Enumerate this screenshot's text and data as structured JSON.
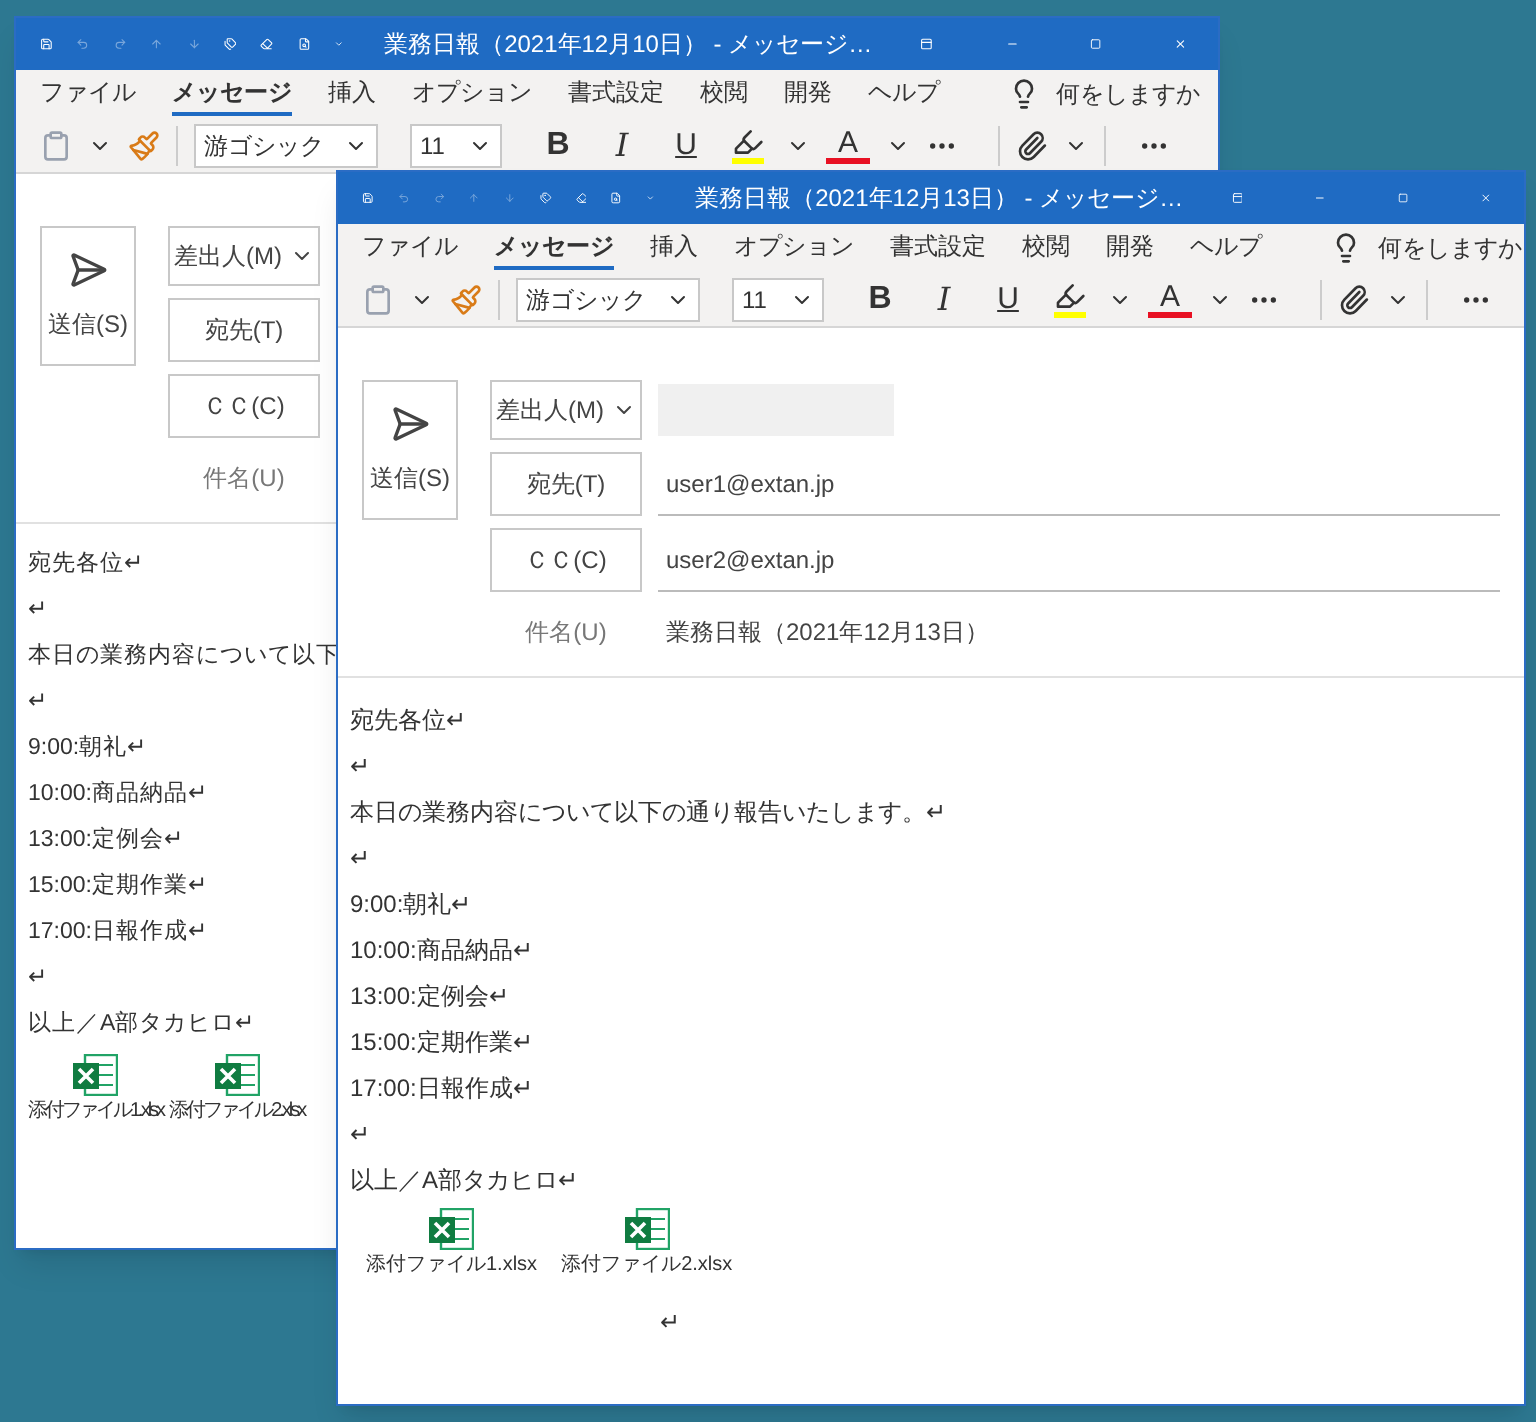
{
  "windows": [
    {
      "title": "業務日報（2021年12月10日） - メッセージ…",
      "menu": [
        {
          "label": "ファイル",
          "selected": false
        },
        {
          "label": "メッセージ",
          "selected": true
        },
        {
          "label": "挿入",
          "selected": false
        },
        {
          "label": "オプション",
          "selected": false
        },
        {
          "label": "書式設定",
          "selected": false
        },
        {
          "label": "校閲",
          "selected": false
        },
        {
          "label": "開発",
          "selected": false
        },
        {
          "label": "ヘルプ",
          "selected": false
        }
      ],
      "tell_me": "何をしますか",
      "font": "游ゴシック",
      "font_size": "11",
      "bold": "B",
      "italic": "I",
      "underline": "U",
      "font_color": "A",
      "send": "送信(S)",
      "from_label": "差出人(M)",
      "to_label": "宛先(T)",
      "cc_label": "ＣＣ(C)",
      "subject_label": "件名(U)",
      "body": [
        "宛先各位↵",
        "↵",
        "本日の業務内容について以下",
        "↵",
        "9:00:朝礼↵",
        "10:00:商品納品↵",
        "13:00:定例会↵",
        "15:00:定期作業↵",
        "17:00:日報作成↵",
        "↵",
        "以上／A部タカヒロ↵"
      ],
      "attachments": [
        "添付ファイル1.xlsx",
        "添付ファイル2.xlsx"
      ]
    },
    {
      "title": "業務日報（2021年12月13日） - メッセージ…",
      "menu": [
        {
          "label": "ファイル",
          "selected": false
        },
        {
          "label": "メッセージ",
          "selected": true
        },
        {
          "label": "挿入",
          "selected": false
        },
        {
          "label": "オプション",
          "selected": false
        },
        {
          "label": "書式設定",
          "selected": false
        },
        {
          "label": "校閲",
          "selected": false
        },
        {
          "label": "開発",
          "selected": false
        },
        {
          "label": "ヘルプ",
          "selected": false
        }
      ],
      "tell_me": "何をしますか",
      "font": "游ゴシック",
      "font_size": "11",
      "bold": "B",
      "italic": "I",
      "underline": "U",
      "font_color": "A",
      "send": "送信(S)",
      "from_label": "差出人(M)",
      "to_label": "宛先(T)",
      "to_value": "user1@extan.jp",
      "cc_label": "ＣＣ(C)",
      "cc_value": "user2@extan.jp",
      "subject_label": "件名(U)",
      "subject_value": "業務日報（2021年12月13日）",
      "body": [
        "宛先各位↵",
        "↵",
        "本日の業務内容について以下の通り報告いたします。↵",
        "↵",
        "9:00:朝礼↵",
        "10:00:商品納品↵",
        "13:00:定例会↵",
        "15:00:定期作業↵",
        "17:00:日報作成↵",
        "↵",
        "以上／A部タカヒロ↵"
      ],
      "attachments": [
        "添付ファイル1.xlsx",
        "添付ファイル2.xlsx"
      ],
      "end_mark": "↵"
    }
  ]
}
